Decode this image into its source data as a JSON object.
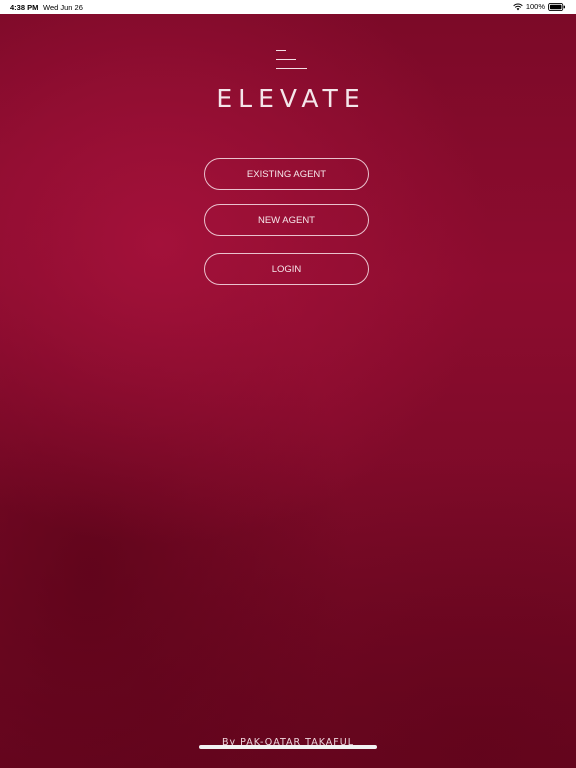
{
  "status_bar": {
    "time": "4:38 PM",
    "date": "Wed Jun 26",
    "battery": "100%",
    "icons": [
      "wifi-icon",
      "battery-icon"
    ]
  },
  "app": {
    "logo_text": "ELEVATE",
    "logo_icon": "menu-lines-logo-icon",
    "buttons": {
      "existing_agent": "EXISTING AGENT",
      "new_agent": "NEW AGENT",
      "login": "LOGIN"
    },
    "footer": "By PAK-QATAR TAKAFUL"
  },
  "colors": {
    "background_primary": "#8d0c2f",
    "background_highlight": "#a3113a",
    "background_dark": "#6a0620",
    "text_light": "#f4e6ea",
    "button_border": "#f8e1e8"
  }
}
